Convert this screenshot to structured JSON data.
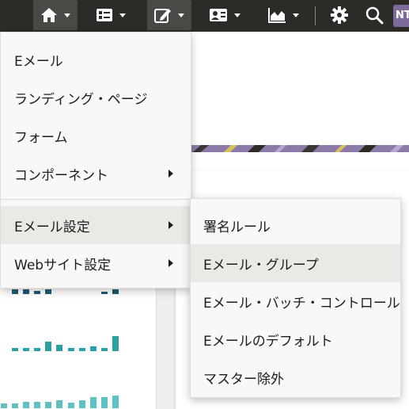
{
  "toolbar": {
    "avatar_initials": "NT",
    "buttons": [
      {
        "name": "home-icon",
        "active": true
      },
      {
        "name": "campaign-icon",
        "active": false
      },
      {
        "name": "edit-icon",
        "active": true
      },
      {
        "name": "contacts-icon",
        "active": false
      },
      {
        "name": "analytics-icon",
        "active": false
      }
    ]
  },
  "main_menu": {
    "items": [
      {
        "label": "Eメール",
        "has_submenu": false
      },
      {
        "label": "ランディング・ページ",
        "has_submenu": false
      },
      {
        "label": "フォーム",
        "has_submenu": false
      },
      {
        "label": "コンポーネント",
        "has_submenu": true
      },
      {
        "label": "Eメール設定",
        "has_submenu": true,
        "highlighted": true
      },
      {
        "label": "Webサイト設定",
        "has_submenu": true
      }
    ]
  },
  "sub_menu": {
    "items": [
      {
        "label": "署名ルール"
      },
      {
        "label": "Eメール・グループ",
        "highlighted": true
      },
      {
        "label": "Eメール・バッチ・コントロール"
      },
      {
        "label": "Eメールのデフォルト"
      },
      {
        "label": "マスター除外"
      }
    ]
  },
  "colors": {
    "toolbar_bg": "#2d2b28",
    "menu_bg": "#f9f8f6",
    "highlight": "#ebe9e6",
    "bar_dark": "#1d5b76",
    "bar_mid": "#2aa0a4",
    "bar_light": "#5fc2c2"
  }
}
